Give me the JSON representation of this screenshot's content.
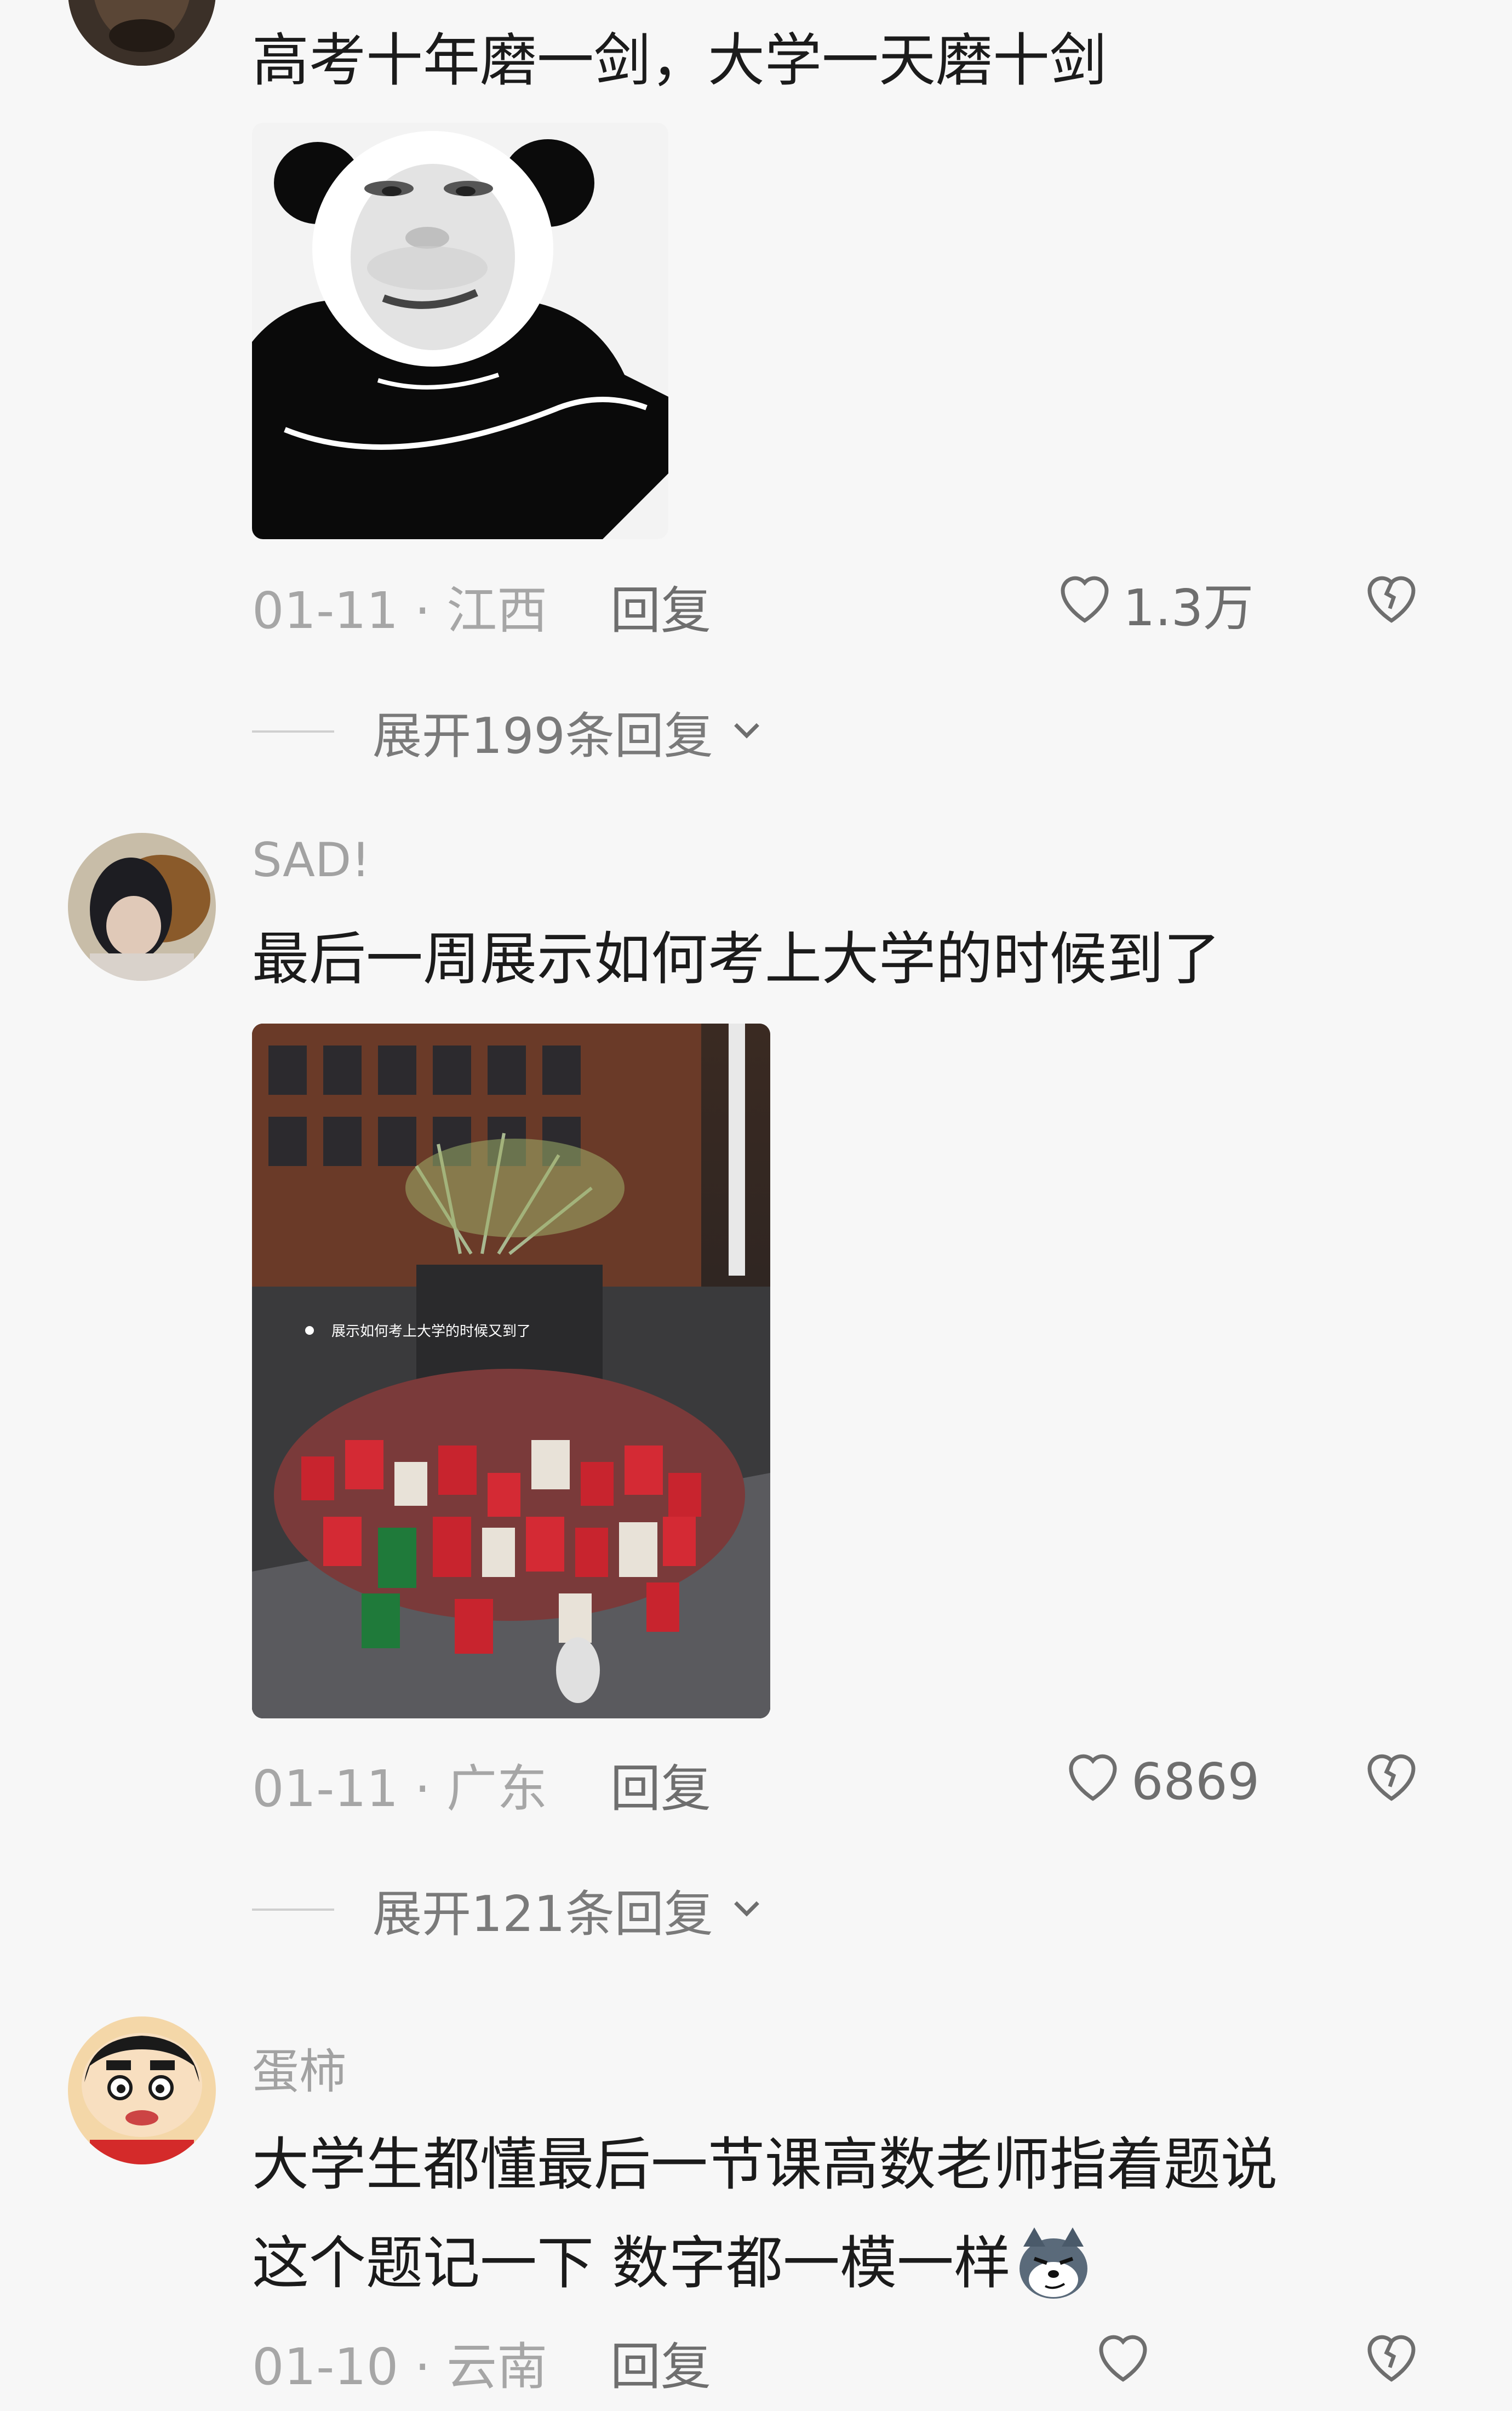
{
  "comments": [
    {
      "text": "高考十年磨一剑，大学一天磨十剑",
      "date_location": "01-11 · 江西",
      "reply_label": "回复",
      "likes": "1.3万",
      "expand_label": "展开199条回复",
      "image_icon": "panda-meme-image"
    },
    {
      "username": "SAD!",
      "text": "最后一周展示如何考上大学的时候到了",
      "image_caption": "展示如何考上大学的时候又到了",
      "date_location": "01-11 · 广东",
      "reply_label": "回复",
      "likes": "6869",
      "expand_label": "展开121条回复",
      "image_icon": "campus-bags-photo"
    },
    {
      "username": "蛋柿",
      "text_line1": "大学生都懂最后一节课高数老师指着题说",
      "text_line2": "这个题记一下 数字都一模一样",
      "date_location": "01-10 · 云南",
      "reply_label": "回复",
      "emoji_icon": "smirking-dog-emoji"
    }
  ]
}
